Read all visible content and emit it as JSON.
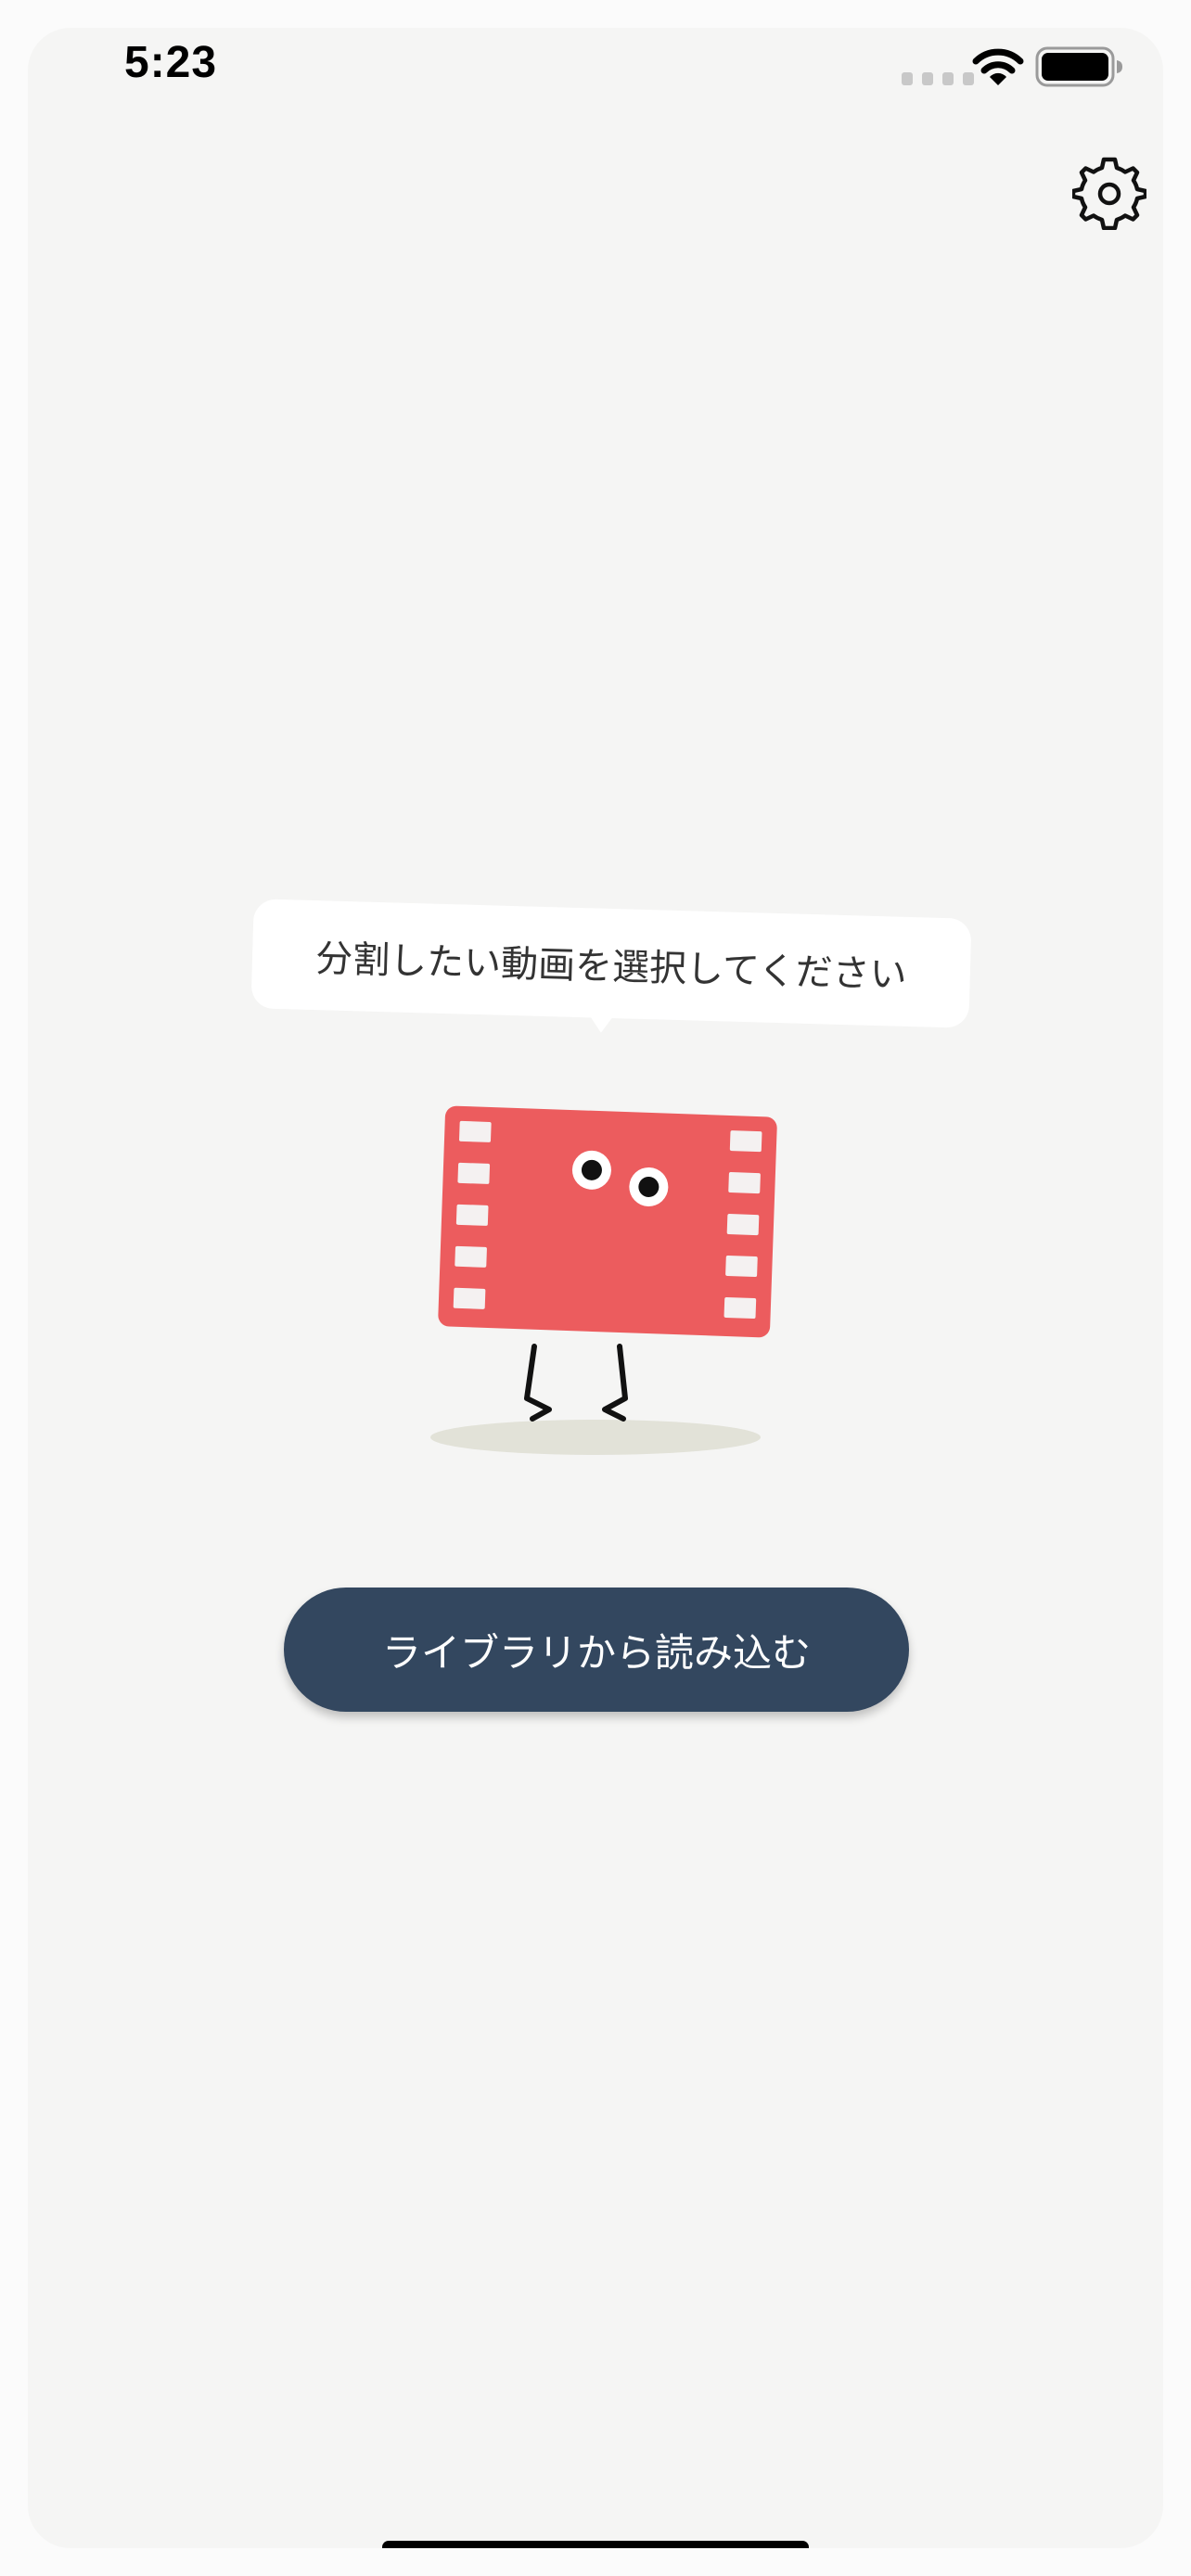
{
  "status_bar": {
    "time": "5:23",
    "icons": [
      "cellular-signal-icon",
      "wifi-icon",
      "battery-icon"
    ]
  },
  "toolbar": {
    "settings_icon": "gear-icon"
  },
  "prompt": {
    "message": "分割したい動画を選択してください"
  },
  "mascot": {
    "description_icon": "film-strip-mascot-icon"
  },
  "actions": {
    "load_from_library_label": "ライブラリから読み込む"
  },
  "colors": {
    "background": "#f5f5f4",
    "button": "#33475f",
    "button_text": "#ffffff",
    "mascot_body": "#ec5c5e",
    "mascot_shadow": "#e2e2d8",
    "bubble": "#ffffff",
    "bubble_text": "#333333"
  }
}
